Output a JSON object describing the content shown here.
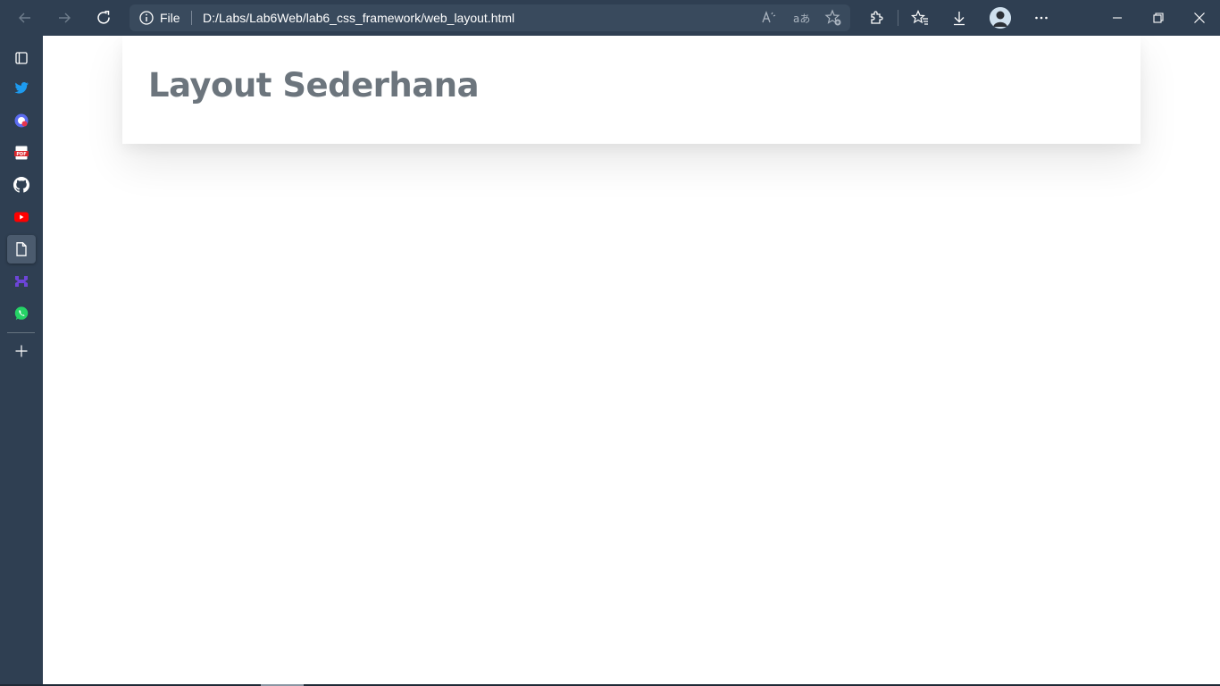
{
  "toolbar": {
    "back_icon": "arrow-left-icon",
    "forward_icon": "arrow-right-icon",
    "refresh_icon": "refresh-icon",
    "site_info_label": "File",
    "url": "D:/Labs/Lab6Web/lab6_css_framework/web_layout.html",
    "read_aloud_icon": "read-aloud-icon",
    "translate_icon": "translate-icon",
    "favorite_add_icon": "star-add-icon",
    "extensions_icon": "puzzle-icon",
    "favorites_icon": "favorites-icon",
    "downloads_icon": "download-icon",
    "profile_icon": "avatar",
    "more_icon": "more-icon"
  },
  "window_controls": {
    "minimize_icon": "minimize-icon",
    "restore_icon": "restore-icon",
    "close_icon": "close-icon"
  },
  "sidebar": {
    "items": [
      {
        "name": "tab-actions-icon"
      },
      {
        "name": "twitter-icon"
      },
      {
        "name": "app-icon"
      },
      {
        "name": "pdf-icon"
      },
      {
        "name": "github-icon"
      },
      {
        "name": "youtube-icon"
      },
      {
        "name": "page-icon",
        "active": true
      },
      {
        "name": "app-icon"
      },
      {
        "name": "whatsapp-icon"
      }
    ],
    "add_icon": "plus-icon"
  },
  "page": {
    "title": "Layout Sederhana"
  },
  "colors": {
    "chrome": "#2f3f52",
    "address_bar": "#394a5d",
    "title_text": "#6c757d",
    "page_bg": "#ffffff",
    "twitter": "#1d9bf0",
    "youtube": "#ff0000",
    "whatsapp": "#25d366"
  }
}
